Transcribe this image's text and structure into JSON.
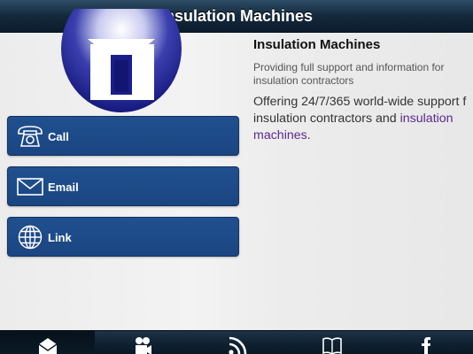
{
  "header": {
    "title": "Insulation Machines"
  },
  "actions": [
    {
      "label": "Call",
      "icon": "phone-icon"
    },
    {
      "label": "Email",
      "icon": "envelope-icon"
    },
    {
      "label": "Link",
      "icon": "globe-icon"
    }
  ],
  "content": {
    "title": "Insulation Machines",
    "subtitle": "Providing full support and information for insulation contractors",
    "body_line1": "Offering 24/7/365 world-wide support f",
    "body_line2_prefix": "insulation contractors and ",
    "body_link_part1": "insulation",
    "body_link_part2": "machines",
    "body_suffix": "."
  },
  "tabs": [
    {
      "icon": "envelope-open-icon",
      "active": true
    },
    {
      "icon": "video-camera-icon",
      "active": false
    },
    {
      "icon": "rss-icon",
      "active": false
    },
    {
      "icon": "book-icon",
      "active": false
    },
    {
      "icon": "facebook-icon",
      "active": false
    }
  ],
  "colors": {
    "header_bg": "#14293c",
    "button_bg": "#1f4c8b",
    "link": "#5c2a8a",
    "logo_blue": "#1a1e8c"
  }
}
